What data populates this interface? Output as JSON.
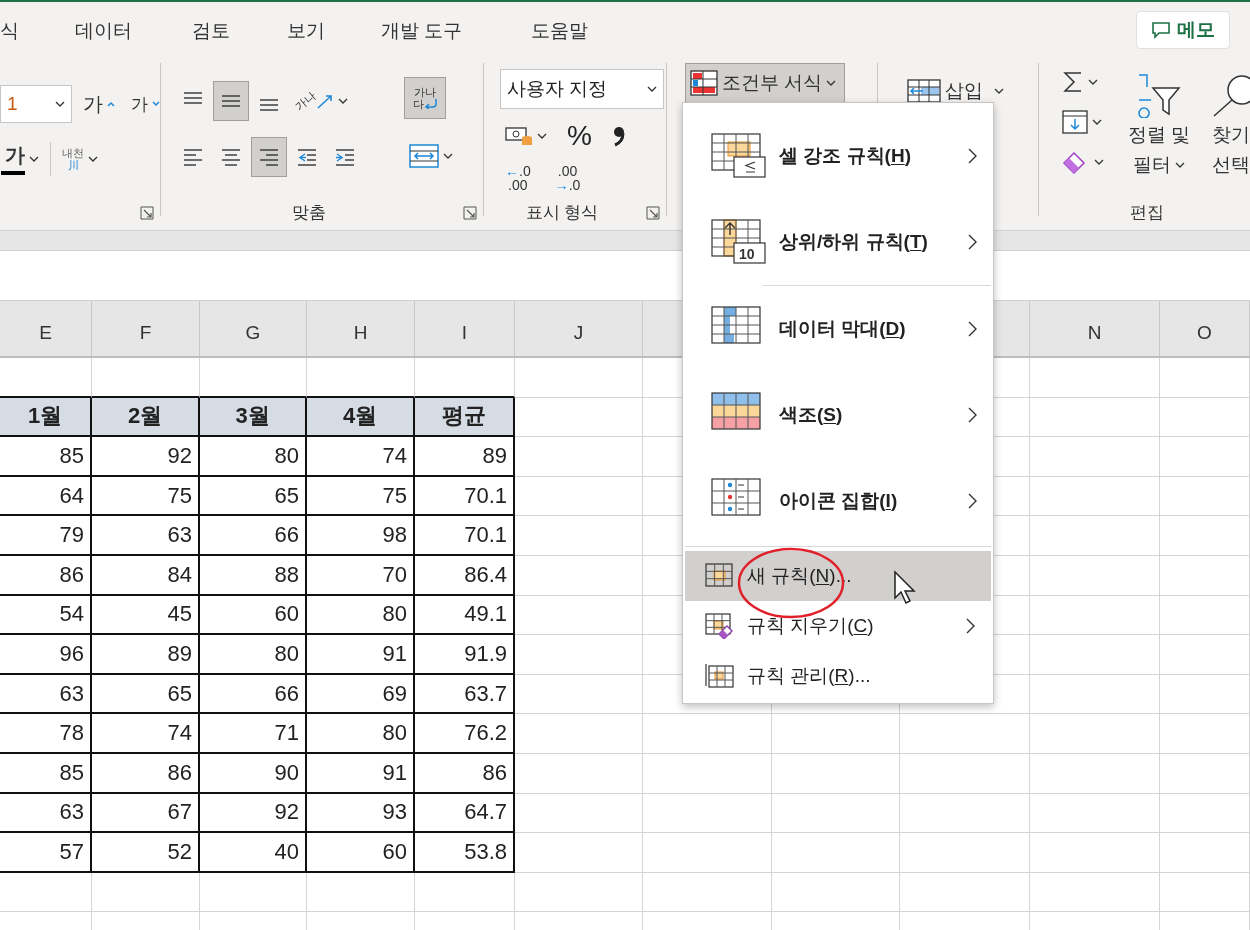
{
  "tabs": [
    {
      "label": "식",
      "selected": false
    },
    {
      "label": "데이터",
      "selected": false
    },
    {
      "label": "검토",
      "selected": false
    },
    {
      "label": "보기",
      "selected": false
    },
    {
      "label": "개발 도구",
      "selected": false
    },
    {
      "label": "도움말",
      "selected": false
    }
  ],
  "memo_button": {
    "label": "메모"
  },
  "font_group": {
    "size_value": "1",
    "grow_label": "가",
    "shrink_label": "가",
    "underline_label": "가",
    "phonetic_top": "내천",
    "phonetic_bottom": "川"
  },
  "alignment_group": {
    "label": "맞춤",
    "orientation_text": "가나",
    "buttons": [
      {
        "selected": false
      },
      {
        "selected": true
      },
      {
        "selected": false
      },
      {
        "selected": false
      },
      {
        "selected": false
      },
      {
        "selected": true
      },
      {
        "selected": false
      },
      {
        "selected": false
      }
    ],
    "wrap_text": {
      "top": "가나",
      "bottom": "다",
      "selected": true
    }
  },
  "number_group": {
    "label": "표시 형식",
    "format": "사용자 지정",
    "percent": "%",
    "increase_decimal": {
      "arrow": "←",
      "top": ".0",
      "bottom": ".00"
    },
    "decrease_decimal": {
      "arrow": "→",
      "top": ".00",
      "bottom": ".0"
    }
  },
  "styles_group": {
    "conditional_format": {
      "label": "조건부 서식",
      "selected": true
    }
  },
  "cells_group": {
    "insert": {
      "label": "삽입"
    }
  },
  "editing_group": {
    "label": "편집",
    "sort_filter": {
      "line1": "정렬 및",
      "line2": "필터"
    },
    "find_select": {
      "line1": "찾기",
      "line2": "선택"
    }
  },
  "sheet": {
    "column_headers": [
      "E",
      "F",
      "G",
      "H",
      "I",
      "J",
      "N",
      "O"
    ],
    "table": {
      "header": [
        "1월",
        "2월",
        "3월",
        "4월",
        "평균"
      ],
      "rows": [
        [
          "85",
          "92",
          "80",
          "74",
          "89"
        ],
        [
          "64",
          "75",
          "65",
          "75",
          "70.1"
        ],
        [
          "79",
          "63",
          "66",
          "98",
          "70.1"
        ],
        [
          "86",
          "84",
          "88",
          "70",
          "86.4"
        ],
        [
          "54",
          "45",
          "60",
          "80",
          "49.1"
        ],
        [
          "96",
          "89",
          "80",
          "91",
          "91.9"
        ],
        [
          "63",
          "65",
          "66",
          "69",
          "63.7"
        ],
        [
          "78",
          "74",
          "71",
          "80",
          "76.2"
        ],
        [
          "85",
          "86",
          "90",
          "91",
          "86"
        ],
        [
          "63",
          "67",
          "92",
          "93",
          "64.7"
        ],
        [
          "57",
          "52",
          "40",
          "60",
          "53.8"
        ]
      ]
    }
  },
  "menu": {
    "items": [
      {
        "kind": "large",
        "text": "셀 강조 규칙(",
        "key": "H",
        "after": ")",
        "submenu": true,
        "selected": false
      },
      {
        "kind": "large",
        "text": "상위/하위 규칙(",
        "key": "T",
        "after": ")",
        "submenu": true,
        "selected": false,
        "icon_text": "10"
      },
      {
        "kind": "large",
        "text": "데이터 막대(",
        "key": "D",
        "after": ")",
        "submenu": true,
        "selected": false
      },
      {
        "kind": "large",
        "text": "색조(",
        "key": "S",
        "after": ")",
        "submenu": true,
        "selected": false
      },
      {
        "kind": "large",
        "text": "아이콘 집합(",
        "key": "I",
        "after": ")",
        "submenu": true,
        "selected": false
      },
      {
        "kind": "small",
        "text": "새 규칙(",
        "key": "N",
        "after": ")...",
        "submenu": false,
        "selected": true
      },
      {
        "kind": "small",
        "text": "규칙 지우기(",
        "key": "C",
        "after": ")",
        "submenu": true,
        "selected": false
      },
      {
        "kind": "small",
        "text": "규칙 관리(",
        "key": "R",
        "after": ")...",
        "submenu": false,
        "selected": false
      }
    ]
  }
}
